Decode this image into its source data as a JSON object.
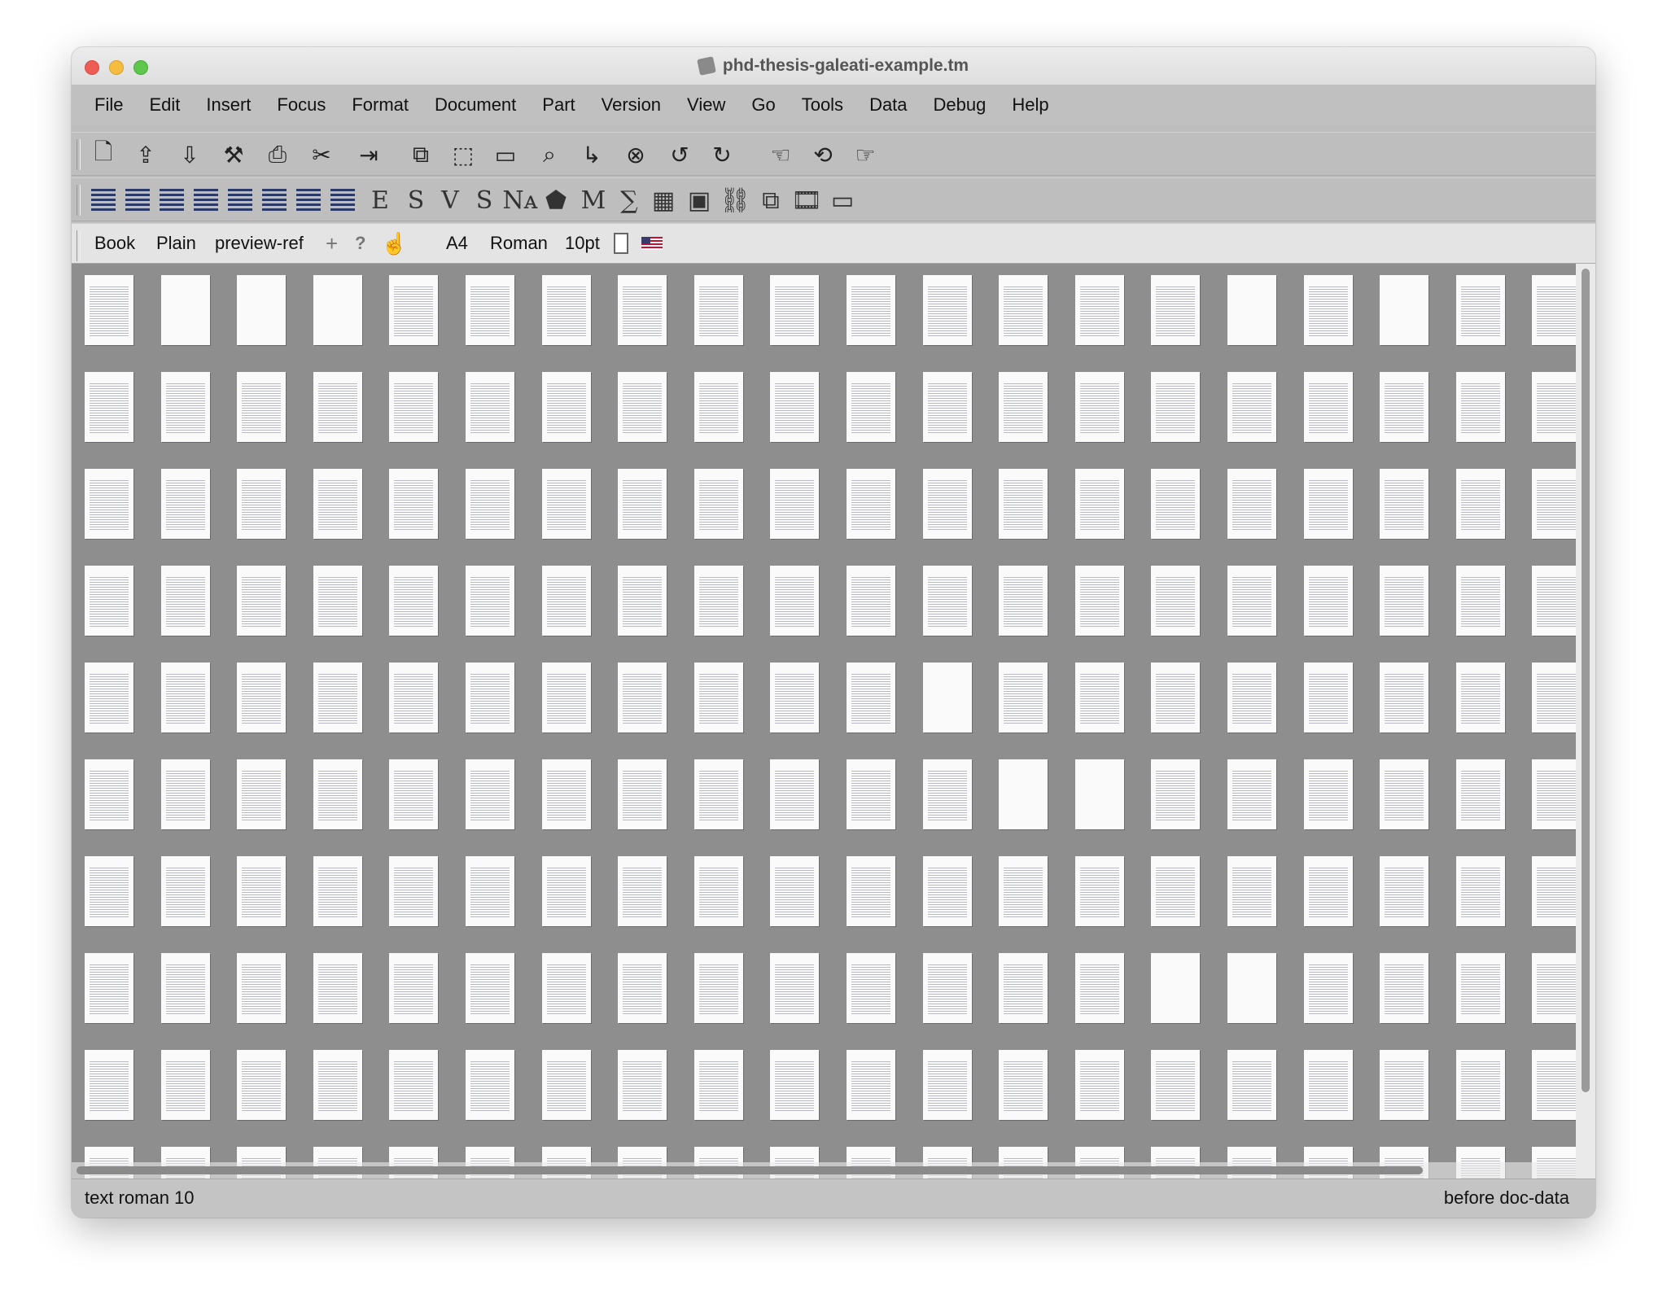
{
  "window": {
    "title": "phd-thesis-galeati-example.tm"
  },
  "menubar": [
    "File",
    "Edit",
    "Insert",
    "Focus",
    "Format",
    "Document",
    "Part",
    "Version",
    "View",
    "Go",
    "Tools",
    "Data",
    "Debug",
    "Help"
  ],
  "toolbar_main": [
    {
      "name": "new-document-icon",
      "glyph": "🗋"
    },
    {
      "name": "open-document-icon",
      "glyph": "⇪"
    },
    {
      "name": "save-document-icon",
      "glyph": "⇩"
    },
    {
      "name": "build-icon",
      "glyph": "⚒"
    },
    {
      "name": "print-icon",
      "glyph": "⎙"
    },
    {
      "name": "preferences-tools-icon",
      "glyph": "✂"
    },
    {
      "name": "export-icon",
      "glyph": "⇥"
    },
    {
      "name": "copy-icon",
      "glyph": "⧉"
    },
    {
      "name": "cut-icon",
      "glyph": "⬚"
    },
    {
      "name": "paste-icon",
      "glyph": "▭"
    },
    {
      "name": "search-icon",
      "glyph": "⌕"
    },
    {
      "name": "replace-icon",
      "glyph": "↳"
    },
    {
      "name": "spell-check-icon",
      "glyph": "⊗"
    },
    {
      "name": "undo-icon",
      "glyph": "↺"
    },
    {
      "name": "redo-icon",
      "glyph": "↻"
    },
    {
      "name": "go-back-icon",
      "glyph": "☜"
    },
    {
      "name": "go-up-icon",
      "glyph": "⟲"
    },
    {
      "name": "go-forward-icon",
      "glyph": "☞"
    }
  ],
  "toolbar_format": [
    {
      "name": "paragraph-left-icon",
      "glyph": "lines"
    },
    {
      "name": "paragraph-justify-icon",
      "glyph": "lines"
    },
    {
      "name": "theorem-icon",
      "glyph": "lines"
    },
    {
      "name": "highlight-icon",
      "glyph": "lines"
    },
    {
      "name": "center-icon",
      "glyph": "lines"
    },
    {
      "name": "itemize-icon",
      "glyph": "lines"
    },
    {
      "name": "enumerate-icon",
      "glyph": "lines"
    },
    {
      "name": "description-icon",
      "glyph": "lines"
    },
    {
      "name": "emphasize-icon",
      "glyph": "E"
    },
    {
      "name": "strong-icon",
      "glyph": "S"
    },
    {
      "name": "verbatim-icon",
      "glyph": "V"
    },
    {
      "name": "sans-serif-icon",
      "glyph": "S"
    },
    {
      "name": "name-icon",
      "glyph": "Nᴀ"
    },
    {
      "name": "tag-icon",
      "glyph": "⬟"
    },
    {
      "name": "math-mode-icon",
      "glyph": "M"
    },
    {
      "name": "formula-icon",
      "glyph": "∑"
    },
    {
      "name": "table-icon",
      "glyph": "▦"
    },
    {
      "name": "image-icon",
      "glyph": "▣"
    },
    {
      "name": "link-icon",
      "glyph": "⛓"
    },
    {
      "name": "duplicate-icon",
      "glyph": "⧉"
    },
    {
      "name": "animation-icon",
      "glyph": "🎞"
    },
    {
      "name": "session-icon",
      "glyph": "▭"
    }
  ],
  "context_bar": {
    "book": "Book",
    "plain": "Plain",
    "preview_ref": "preview-ref",
    "plus": "+",
    "question": "?",
    "paper": "A4",
    "font": "Roman",
    "size": "10pt"
  },
  "status": {
    "left": "text roman 10",
    "right": "before doc-data"
  },
  "colors": {
    "canvas": "#8e8e8e",
    "page": "#fafafa",
    "toolbar": "#bebebe"
  }
}
